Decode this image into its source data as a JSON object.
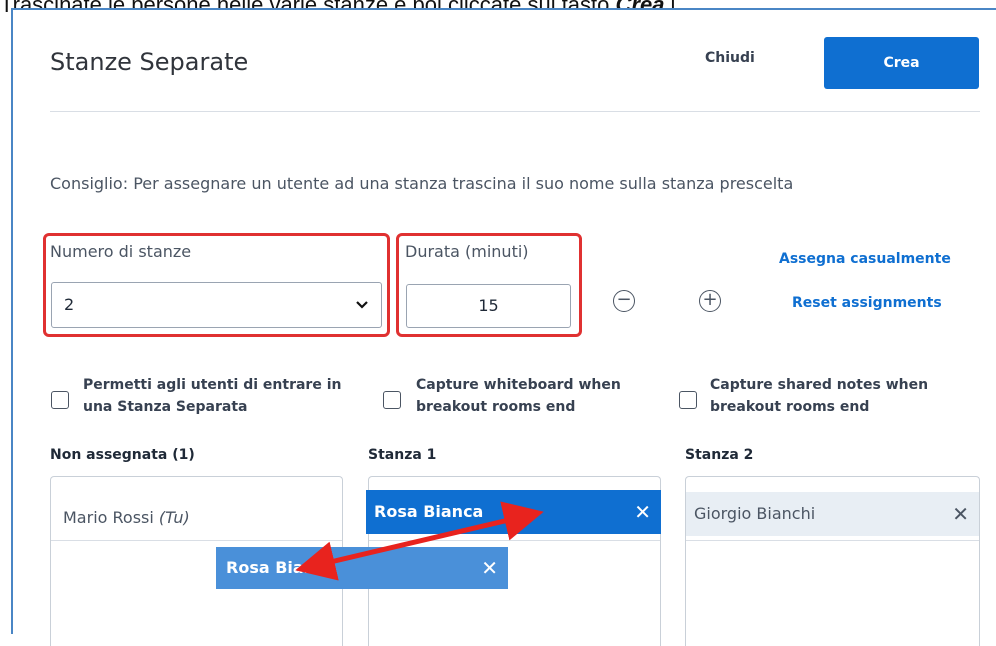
{
  "caption": {
    "text_plain": "Trascinate le persone nelle varie stanze e poi cliccate sul tasto ",
    "text_bold": "Crea",
    "text_tail": " i."
  },
  "modal": {
    "title": "Stanze Separate",
    "close_label": "Chiudi",
    "create_label": "Crea",
    "tip": "Consiglio: Per assegnare un utente ad una stanza trascina il suo nome sulla stanza prescelta"
  },
  "rooms_count": {
    "label": "Numero di stanze",
    "value": "2"
  },
  "duration": {
    "label": "Durata (minuti)",
    "value": "15"
  },
  "stepper": {
    "minus": "−",
    "plus": "+"
  },
  "links": {
    "random": "Assegna casualmente",
    "reset": "Reset assignments"
  },
  "checkboxes": [
    {
      "line1": "Permetti agli utenti di entrare in",
      "line2": "una Stanza Separata"
    },
    {
      "line1": "Capture whiteboard when",
      "line2": "breakout rooms end"
    },
    {
      "line1": "Capture shared notes when",
      "line2": "breakout rooms end"
    }
  ],
  "columns": [
    {
      "title": "Non assegnata (1)",
      "users": [
        {
          "name": "Mario Rossi",
          "suffix": "(Tu)"
        }
      ]
    },
    {
      "title": "Stanza 1",
      "users": [
        {
          "name": "Rosa Bianca"
        }
      ]
    },
    {
      "title": "Stanza 2",
      "users": [
        {
          "name": "Giorgio Bianchi"
        }
      ]
    }
  ],
  "drag_ghost": {
    "name": "Rosa Bianca"
  },
  "remove_glyph": "✕",
  "colors": {
    "accent": "#0f6fd1",
    "highlight": "#e03131",
    "arrow": "#e8231e"
  }
}
